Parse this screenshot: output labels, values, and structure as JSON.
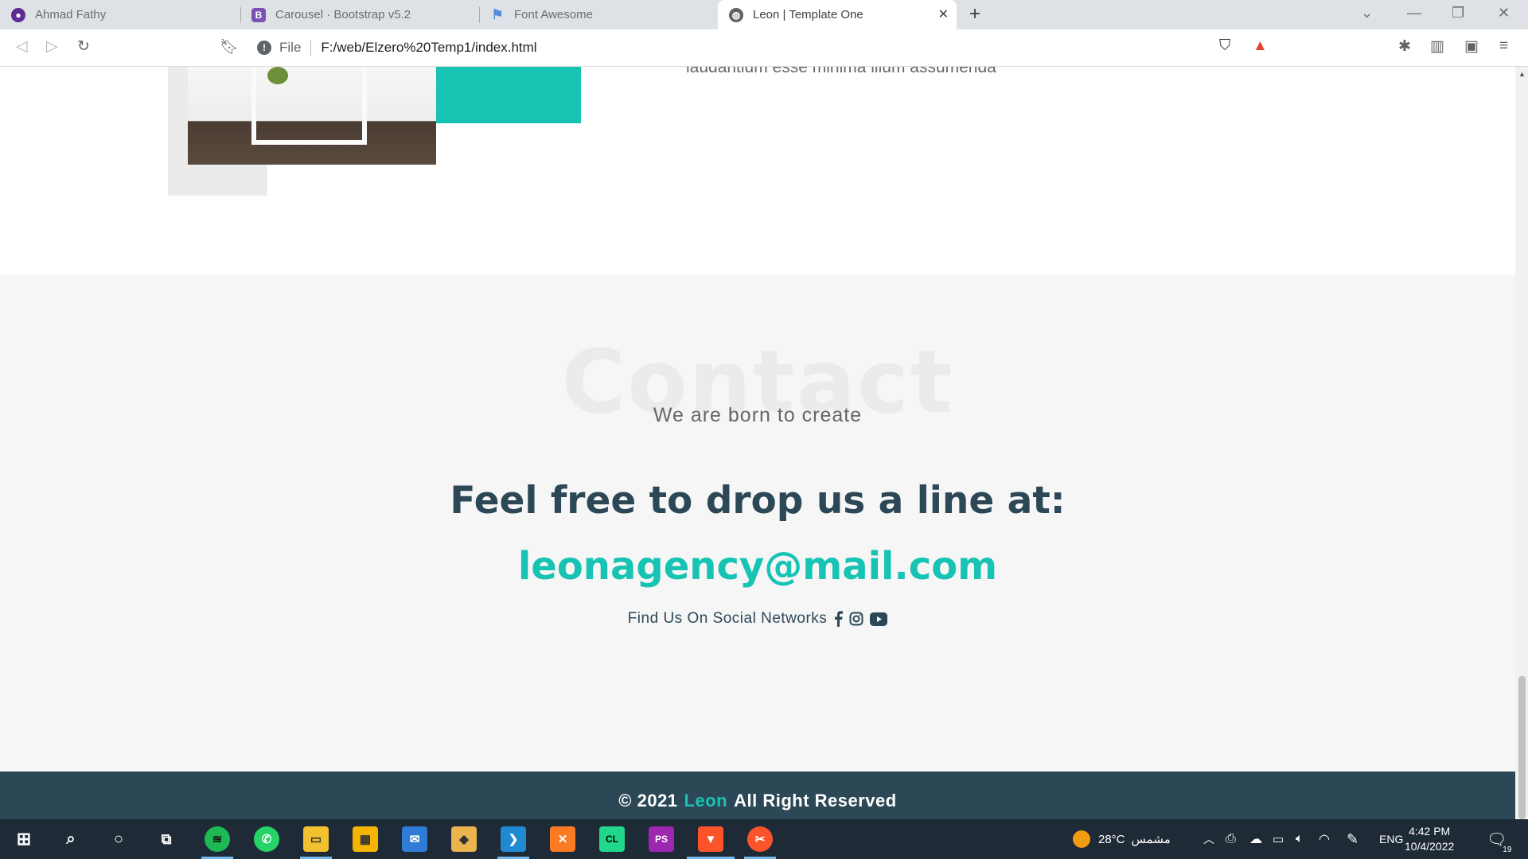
{
  "browser": {
    "tabs": [
      {
        "label": "Ahmad Fathy",
        "icon": "profile-icon",
        "color": "#5c2d91"
      },
      {
        "label": "Carousel · Bootstrap v5.2",
        "icon": "bootstrap-icon",
        "color": "#7952b3"
      },
      {
        "label": "Font Awesome",
        "icon": "flag-icon",
        "color": "#528dd7"
      },
      {
        "label": "Leon | Template One",
        "icon": "globe-icon",
        "color": "#5f6368"
      }
    ],
    "address": {
      "scheme_label": "File",
      "url": "F:/web/Elzero%20Temp1/index.html"
    }
  },
  "page": {
    "about_fragment": "laudantium esse minima illum assumenda",
    "contact": {
      "ghost_title": "Contact",
      "subtitle": "We are born to create",
      "headline": "Feel free to drop us a line at:",
      "email": "leonagency@mail.com",
      "social_label": "Find Us On Social Networks",
      "social_icons": [
        "facebook-icon",
        "instagram-icon",
        "youtube-icon"
      ]
    },
    "footer": {
      "prefix": "© 2021",
      "brand": "Leon",
      "suffix": "All Right Reserved"
    }
  },
  "colors": {
    "accent": "#17c3b2",
    "dark": "#2c4857",
    "section_bg": "#f6f6f6"
  },
  "taskbar": {
    "weather": {
      "temp": "28°C",
      "label": "مشمس"
    },
    "lang": "ENG",
    "time": "4:42 PM",
    "date": "10/4/2022",
    "notifications": "19"
  }
}
